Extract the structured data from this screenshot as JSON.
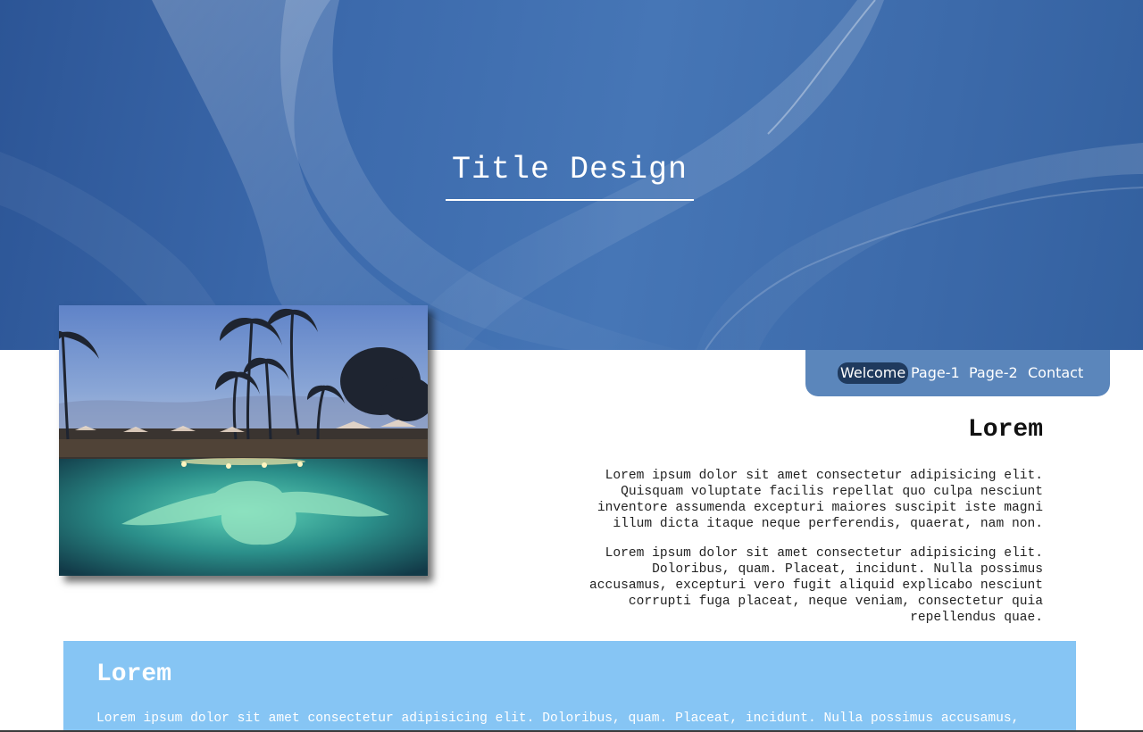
{
  "header": {
    "title": "Title Design"
  },
  "nav": {
    "items": [
      {
        "label": "Welcome",
        "active": true
      },
      {
        "label": "Page-1",
        "active": false
      },
      {
        "label": "Page-2",
        "active": false
      },
      {
        "label": "Contact",
        "active": false
      }
    ]
  },
  "welcome": {
    "heading": "Lorem",
    "paragraphs": [
      "Lorem ipsum dolor sit amet consectetur adipisicing elit. Quisquam voluptate facilis repellat quo culpa nesciunt inventore assumenda excepturi maiores suscipit iste magni illum dicta itaque neque perferendis, quaerat, nam non.",
      "Lorem ipsum dolor sit amet consectetur adipisicing elit. Doloribus, quam. Placeat, incidunt. Nulla possimus accusamus, excepturi vero fugit aliquid explicabo nesciunt corrupti fuga placeat, neque veniam, consectetur quia repellendus quae."
    ]
  },
  "band": {
    "heading": "Lorem",
    "text": "Lorem ipsum dolor sit amet consectetur adipisicing elit. Doloribus, quam. Placeat, incidunt. Nulla possimus accusamus,"
  },
  "colors": {
    "hero_blue": "#3c6aac",
    "nav_bg": "#5b86bb",
    "nav_active": "#1f3a5e",
    "band_bg": "#86c5f4"
  }
}
